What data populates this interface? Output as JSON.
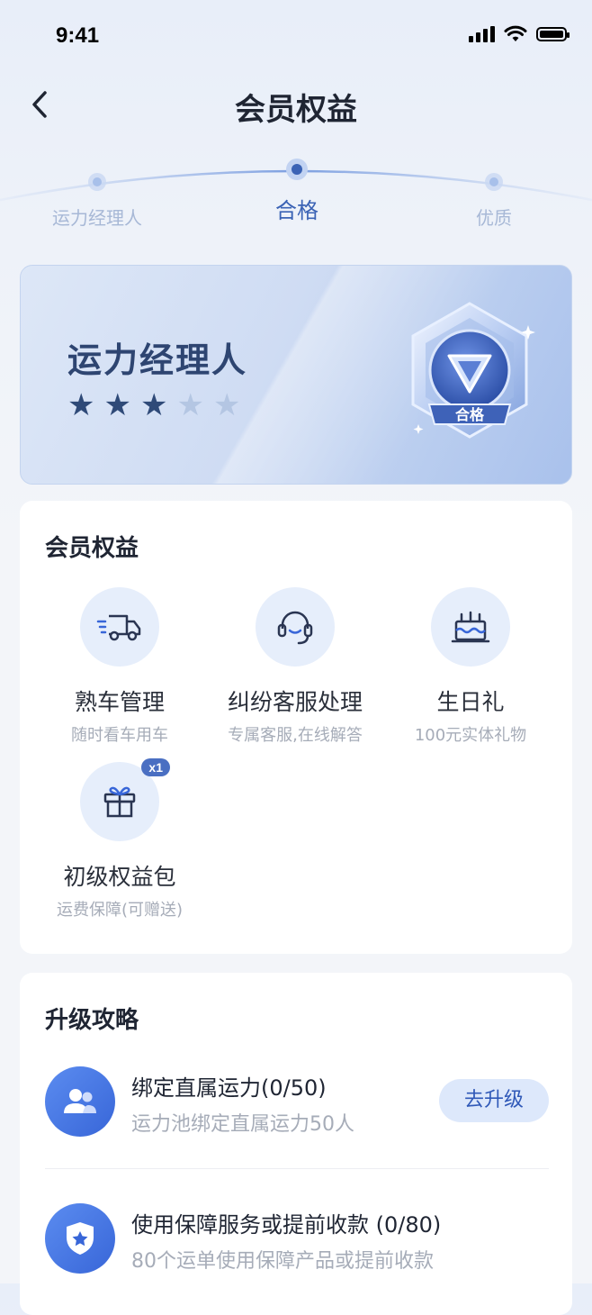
{
  "status_bar": {
    "time": "9:41"
  },
  "nav": {
    "title": "会员权益"
  },
  "levels": [
    {
      "label": "运力经理人",
      "active": false
    },
    {
      "label": "合格",
      "active": true
    },
    {
      "label": "优质",
      "active": false
    }
  ],
  "hero": {
    "title": "运力经理人",
    "stars_total": 5,
    "stars_filled": 3,
    "badge_label": "合格"
  },
  "benefits": {
    "title": "会员权益",
    "items": [
      {
        "name": "熟车管理",
        "desc": "随时看车用车",
        "icon": "truck-icon"
      },
      {
        "name": "纠纷客服处理",
        "desc": "专属客服,在线解答",
        "icon": "headset-icon"
      },
      {
        "name": "生日礼",
        "desc": "100元实体礼物",
        "icon": "cake-icon"
      },
      {
        "name": "初级权益包",
        "desc": "运费保障(可赠送)",
        "icon": "gift-icon",
        "badge": "x1"
      }
    ]
  },
  "upgrade": {
    "title": "升级攻略",
    "tasks": [
      {
        "title": "绑定直属运力(0/50)",
        "desc": "运力池绑定直属运力50人",
        "icon": "users-icon",
        "button": "去升级"
      },
      {
        "title": "使用保障服务或提前收款 (0/80)",
        "desc": "80个运单使用保障产品或提前收款",
        "icon": "shield-icon"
      }
    ]
  },
  "colors": {
    "primary": "#3866d8",
    "accent_text": "#3059b8",
    "hero_title": "#2e4571",
    "muted": "#a6acb8"
  }
}
